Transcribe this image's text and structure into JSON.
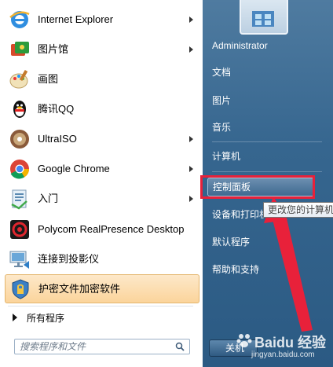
{
  "programs": [
    {
      "label": "Internet Explorer",
      "icon": "internet-explorer-icon",
      "has_arrow": true
    },
    {
      "label": "图片馆",
      "icon": "photo-gallery-icon",
      "has_arrow": true
    },
    {
      "label": "画图",
      "icon": "paint-icon",
      "has_arrow": false
    },
    {
      "label": "腾讯QQ",
      "icon": "qq-penguin-icon",
      "has_arrow": false
    },
    {
      "label": "UltraISO",
      "icon": "ultraiso-disc-icon",
      "has_arrow": true
    },
    {
      "label": "Google Chrome",
      "icon": "chrome-icon",
      "has_arrow": true
    },
    {
      "label": "入门",
      "icon": "getting-started-icon",
      "has_arrow": true
    },
    {
      "label": "Polycom RealPresence Desktop",
      "icon": "polycom-icon",
      "has_arrow": false
    },
    {
      "label": "连接到投影仪",
      "icon": "projector-icon",
      "has_arrow": false
    },
    {
      "label": "护密文件加密软件",
      "icon": "shield-lock-icon",
      "has_arrow": false
    }
  ],
  "all_programs": "所有程序",
  "search": {
    "placeholder": "搜索程序和文件"
  },
  "right_menu": [
    "Administrator",
    "文档",
    "图片",
    "音乐",
    "计算机",
    "控制面板",
    "设备和打印机",
    "默认程序",
    "帮助和支持"
  ],
  "tooltip": "更改您的计算机",
  "shutdown_label": "关机",
  "watermark": {
    "main": "Baidu 经验",
    "sub": "jingyan.baidu.com"
  },
  "colors": {
    "highlight": "#fbd49b",
    "annotation_red": "#e8213a",
    "right_panel": "#36668f"
  }
}
